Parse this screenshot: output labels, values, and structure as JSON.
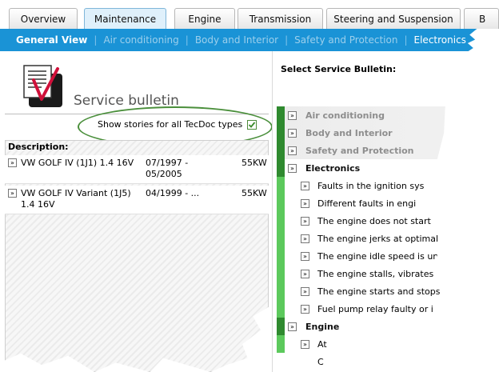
{
  "tabs": [
    "Overview",
    "Maintenance",
    "Engine",
    "Transmission",
    "Steering and Suspension",
    "B"
  ],
  "subnav": {
    "active": "General View",
    "items": [
      "Air conditioning",
      "Body and Interior",
      "Safety and Protection",
      "Electronics"
    ]
  },
  "left": {
    "title": "Service bulletin",
    "show_label": "Show stories for all TecDoc types",
    "checkbox_checked": true,
    "description_header": "Description:",
    "rows": [
      {
        "name": "VW GOLF IV (1J1) 1.4 16V",
        "date": "07/1997 - 05/2005",
        "kw": "55KW"
      },
      {
        "name": "VW GOLF IV Variant (1J5) 1.4 16V",
        "date": "04/1999 - ...",
        "kw": "55KW"
      }
    ]
  },
  "right": {
    "title": "Select Service Bulletin:",
    "categories": [
      {
        "label": "Air conditioning",
        "faded": true
      },
      {
        "label": "Body and Interior",
        "faded": true
      },
      {
        "label": "Safety and Protection",
        "faded": true
      },
      {
        "label": "Electronics",
        "faded": false
      }
    ],
    "electronics_items": [
      "Faults in the ignition sys",
      "Different faults in engi",
      "The engine does not start",
      "The engine jerks at optimal",
      "The engine idle speed is unst",
      "The engine stalls, vibrates and",
      "The engine starts and stops",
      "Fuel pump relay faulty or i"
    ],
    "engine_label": "Engine",
    "engine_items": [
      "At",
      "C"
    ]
  },
  "colors": {
    "subnav_bg": "#1a93d6",
    "tree_dark": "#2f8a2f",
    "tree_light": "#5cc95c",
    "highlight": "#4a8f3b"
  }
}
